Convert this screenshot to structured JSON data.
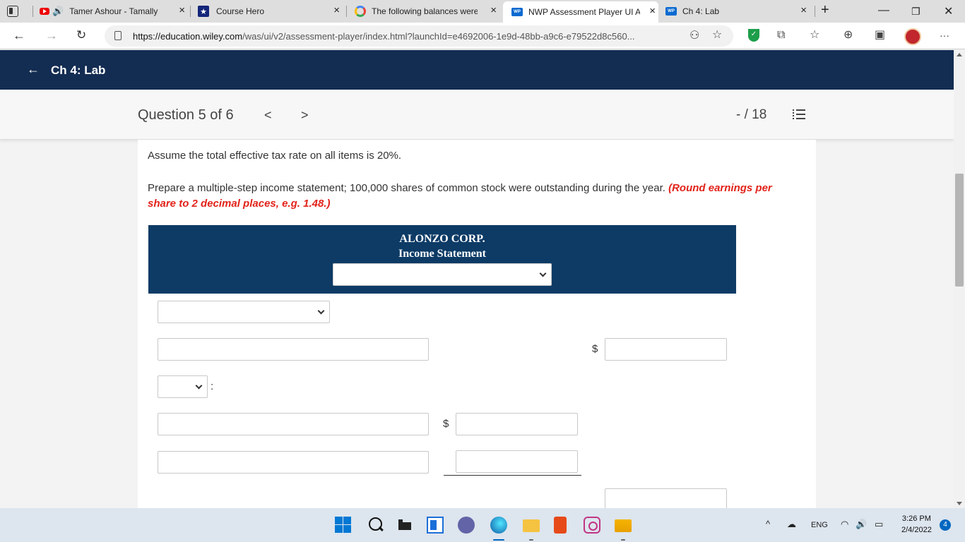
{
  "browser": {
    "tabs": [
      {
        "title": "Tamer Ashour - Tamally",
        "close": "×"
      },
      {
        "title": "Course Hero",
        "close": "×"
      },
      {
        "title": "The following balances were",
        "close": "×"
      },
      {
        "title": "NWP Assessment Player UI A",
        "close": "×"
      },
      {
        "title": "Ch 4: Lab",
        "close": "×"
      }
    ],
    "new_tab": "+",
    "url_host": "https://education.wiley.com",
    "url_path": "/was/ui/v2/assessment-player/index.html?launchId=e4692006-1e9d-48bb-a9c6-e79522d8c560...",
    "wp_badge": "WP",
    "more": "···"
  },
  "header": {
    "back_arrow": "←",
    "title": "Ch 4: Lab"
  },
  "question_bar": {
    "label": "Question 5 of 6",
    "prev": "<",
    "next": ">",
    "score": "- / 18"
  },
  "content": {
    "instruction_1": "Assume the total effective tax rate on all items is 20%.",
    "instruction_2": "Prepare a multiple-step income statement; 100,000 shares of common stock were outstanding during the year.",
    "instruction_2_note": "(Round earnings per share to 2 decimal places, e.g. 1.48.)",
    "statement": {
      "company": "ALONZO CORP.",
      "name": "Income Statement"
    },
    "currency": "$",
    "colon": ":"
  },
  "taskbar": {
    "language": "ENG",
    "time": "3:26 PM",
    "date": "2/4/2022",
    "notifications": "4"
  },
  "colors": {
    "header_bg": "#132c52",
    "statement_bg": "#0d3b66",
    "note_red": "#e2231a"
  }
}
